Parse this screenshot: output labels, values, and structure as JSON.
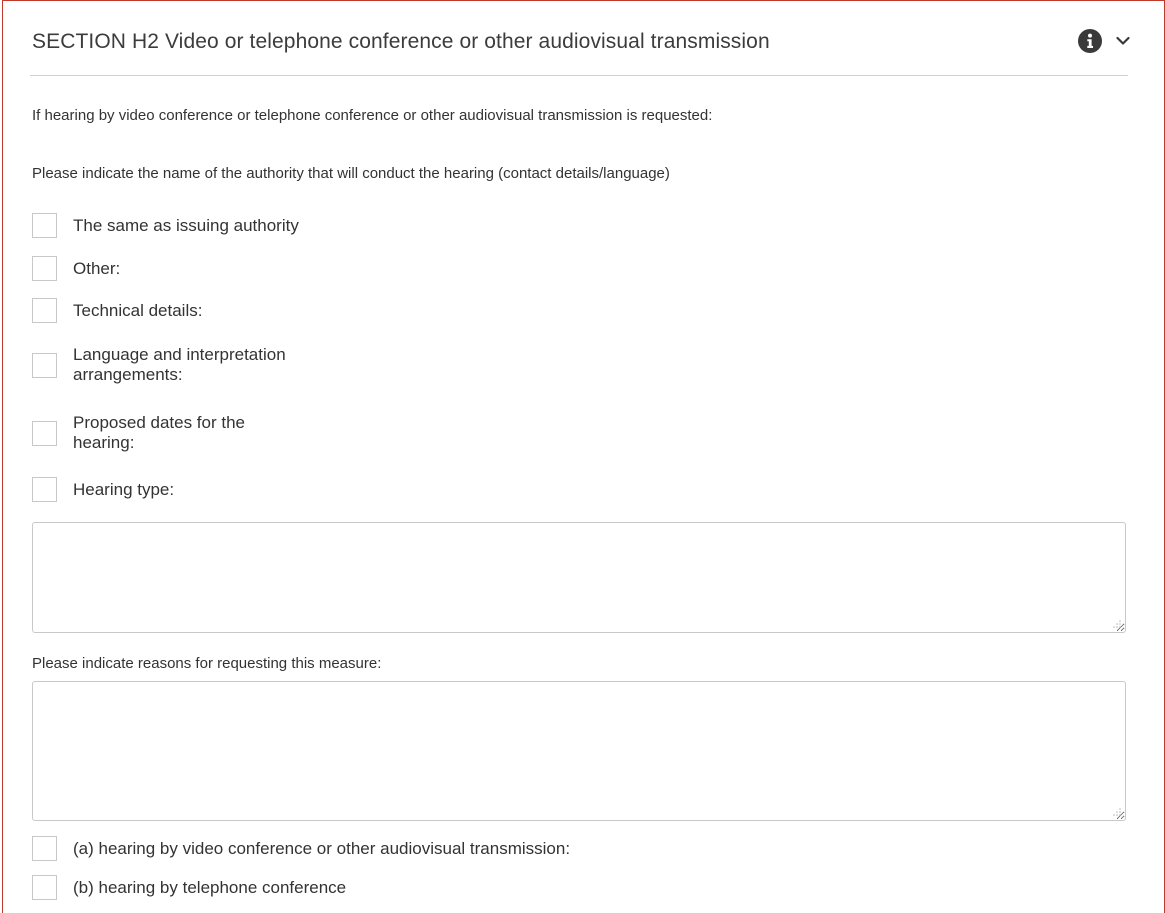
{
  "section": {
    "title": "SECTION H2 Video or telephone conference or other audiovisual transmission",
    "intro": "If hearing by video conference or telephone conference or other audiovisual transmission is requested:",
    "authority_prompt": "Please indicate the name of the authority that will conduct the hearing (contact details/language)",
    "options": [
      {
        "label": "The same as issuing authority",
        "checked": false
      },
      {
        "label": "Other:",
        "checked": false
      },
      {
        "label": "Technical details:",
        "checked": false
      },
      {
        "label": "Language and interpretation arrangements:",
        "checked": false
      },
      {
        "label": "Proposed dates for the hearing:",
        "checked": false
      },
      {
        "label": "Hearing type:",
        "checked": false
      }
    ],
    "details_value": "",
    "reasons_label": "Please indicate reasons for requesting this measure:",
    "reasons_value": "",
    "hearing_types": [
      {
        "label": "(a) hearing by video conference or other audiovisual transmission:",
        "checked": false
      },
      {
        "label": "(b) hearing by telephone conference",
        "checked": false
      }
    ]
  },
  "icons": {
    "info": "info-icon",
    "expand": "chevron-down-icon"
  },
  "colors": {
    "panel_border": "#c0392b",
    "divider": "#d0d0d0",
    "checkbox_border": "#c8c8c8",
    "text": "#333333"
  }
}
